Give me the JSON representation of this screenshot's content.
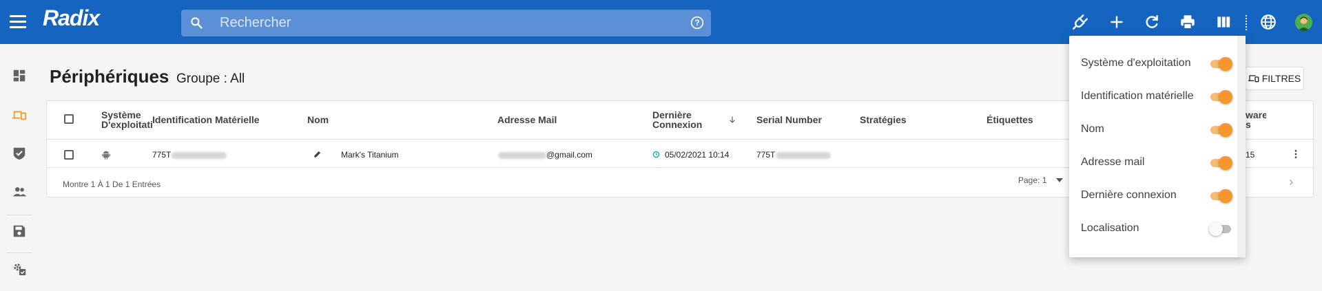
{
  "app": {
    "logo": "Radix"
  },
  "search": {
    "placeholder": "Rechercher"
  },
  "colors": {
    "topbar": "#1565c0",
    "accent": "#f5972a",
    "rail_active": "#f5972a"
  },
  "topbar_icons": [
    "plug-icon",
    "plus-icon",
    "refresh-icon",
    "print-icon",
    "columns-icon",
    "globe-icon",
    "avatar"
  ],
  "sidebar": {
    "items": [
      {
        "icon": "dashboard-icon",
        "active": false
      },
      {
        "icon": "devices-icon",
        "active": true
      },
      {
        "icon": "shield-check-icon",
        "active": false
      },
      {
        "icon": "users-icon",
        "active": false
      },
      {
        "icon": "save-icon",
        "active": false
      },
      {
        "icon": "settings-apps-icon",
        "active": false
      }
    ]
  },
  "page": {
    "title": "Périphériques",
    "group": "Groupe : All",
    "filters_label": "FILTRES"
  },
  "table": {
    "columns": {
      "os": "Système D'exploitati",
      "hw_id": "Identification Matérielle",
      "name": "Nom",
      "mail": "Adresse Mail",
      "last_conn": "Dernière Connexion",
      "serial": "Serial Number",
      "strategies": "Stratégies",
      "tags": "Étiquettes",
      "firmware": "ware s"
    },
    "row": {
      "os_icon": "android-icon",
      "hw_id_prefix": "775T",
      "name": "Mark's Titanium",
      "mail_suffix": "@gmail.com",
      "last_conn": "05/02/2021 10:14",
      "serial_prefix": "775T",
      "firmware_tail": "15"
    },
    "footer": {
      "summary": "Montre 1 À 1 De 1 Entrées",
      "page": "Page: 1"
    }
  },
  "column_menu": {
    "items": [
      {
        "label": "Système d'exploitation",
        "on": true
      },
      {
        "label": "Identification matérielle",
        "on": true
      },
      {
        "label": "Nom",
        "on": true
      },
      {
        "label": "Adresse mail",
        "on": true
      },
      {
        "label": "Dernière connexion",
        "on": true
      },
      {
        "label": "Localisation",
        "on": false
      }
    ]
  }
}
